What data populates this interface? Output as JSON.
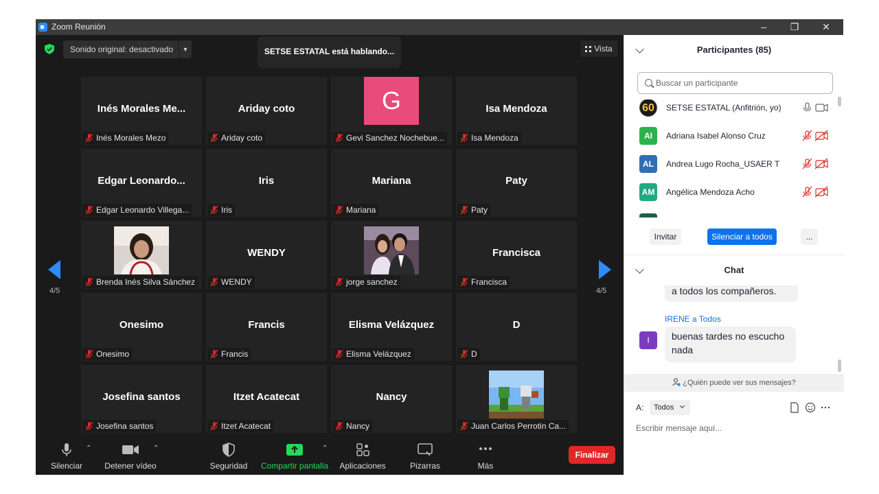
{
  "window": {
    "title": "Zoom Reunión"
  },
  "topbar": {
    "sound_label": "Sonido original: desactivado",
    "speaking": "SETSE ESTATAL está hablando...",
    "view_label": "Vista"
  },
  "grid": {
    "page": "4/5",
    "tiles": [
      {
        "big": "Inés  Morales  Me...",
        "label": "Inés Morales Mezo"
      },
      {
        "big": "Ariday coto",
        "label": "Ariday coto"
      },
      {
        "avatar": "G",
        "label": "Gevi Sanchez Nochebue..."
      },
      {
        "big": "Isa Mendoza",
        "label": "Isa Mendoza"
      },
      {
        "big": "Edgar  Leonardo...",
        "label": "Edgar Leonardo Villega..."
      },
      {
        "big": "Iris",
        "label": "Iris"
      },
      {
        "big": "Mariana",
        "label": "Mariana"
      },
      {
        "big": "Paty",
        "label": "Paty"
      },
      {
        "photo": "woman",
        "label": "Brenda Inés Silva Sánchez"
      },
      {
        "big": "WENDY",
        "label": "WENDY"
      },
      {
        "photo": "couple",
        "label": "jorge sanchez"
      },
      {
        "big": "Francisca",
        "label": "Francisca"
      },
      {
        "big": "Onesimo",
        "label": "Onesimo"
      },
      {
        "big": "Francis",
        "label": "Francis"
      },
      {
        "big": "Elisma Velázquez",
        "label": "Elisma Velázquez"
      },
      {
        "big": "D",
        "label": "D"
      },
      {
        "big": "Josefina santos",
        "label": "Josefina santos"
      },
      {
        "big": "Itzet Acatecat",
        "label": "Itzet Acatecat"
      },
      {
        "big": "Nancy",
        "label": "Nancy"
      },
      {
        "photo": "minecraft",
        "label": "Juan Carlos Perrotin Ca..."
      }
    ]
  },
  "toolbar": {
    "mute": "Silenciar",
    "video": "Detener vídeo",
    "security": "Seguridad",
    "share": "Compartir pantalla",
    "apps": "Aplicaciones",
    "whiteboards": "Pizarras",
    "more": "Más",
    "end": "Finalizar"
  },
  "participants": {
    "title": "Participantes (85)",
    "search_placeholder": "Buscar un participante",
    "list": [
      {
        "initials": "60",
        "name": "SETSE ESTATAL (Anfitrión, yo)",
        "color": "#1a1a1a"
      },
      {
        "initials": "AI",
        "name": "Adriana Isabel Alonso Cruz",
        "color": "#2bb24c"
      },
      {
        "initials": "AL",
        "name": "Andrea Lugo Rocha_USAER T",
        "color": "#2f6fb5"
      },
      {
        "initials": "AM",
        "name": "Angélica Mendoza Acho",
        "color": "#22a883"
      }
    ],
    "invite": "Invitar",
    "mute_all": "Silenciar a todos",
    "more": "..."
  },
  "chat": {
    "title": "Chat",
    "msg1": "a todos los compañeros.",
    "sender": "IRENE a Todos",
    "sender_initial": "I",
    "msg2": "buenas tardes no escucho nada",
    "who_can_see": "¿Quién puede ver sus mensajes?",
    "to_label": "A:",
    "to_value": "Todos",
    "input_placeholder": "Escribir mensaje aquí..."
  },
  "colors": {
    "accent": "#2d8cff",
    "end": "#e02828",
    "share": "#23d959",
    "mute_red": "#e02828"
  }
}
